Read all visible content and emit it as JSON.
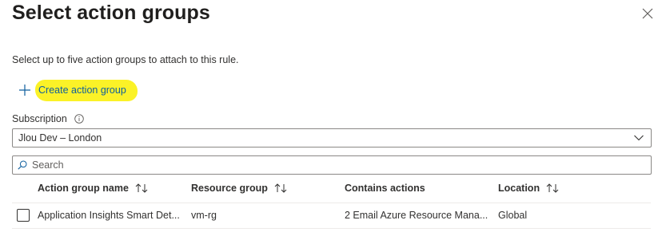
{
  "dialog": {
    "title": "Select action groups",
    "description": "Select up to five action groups to attach to this rule.",
    "create_label": "Create action group",
    "highlight_color": "#fbf227"
  },
  "subscription": {
    "label": "Subscription",
    "selected": "Jlou Dev – London"
  },
  "search": {
    "placeholder": "Search"
  },
  "table": {
    "columns": [
      "Action group name",
      "Resource group",
      "Contains actions",
      "Location"
    ],
    "rows": [
      {
        "checked": false,
        "name": "Application Insights Smart Det...",
        "resource_group": "vm-rg",
        "actions": "2 Email Azure Resource Mana...",
        "location": "Global"
      }
    ]
  },
  "icons": {
    "close": "close-icon",
    "add": "plus-icon",
    "info": "info-icon",
    "dropdown": "chevron-down-icon",
    "search": "search-icon",
    "sort": "sort-icon"
  },
  "colors": {
    "link": "#0e5e9e",
    "border": "#8a8886",
    "text": "#323130"
  }
}
